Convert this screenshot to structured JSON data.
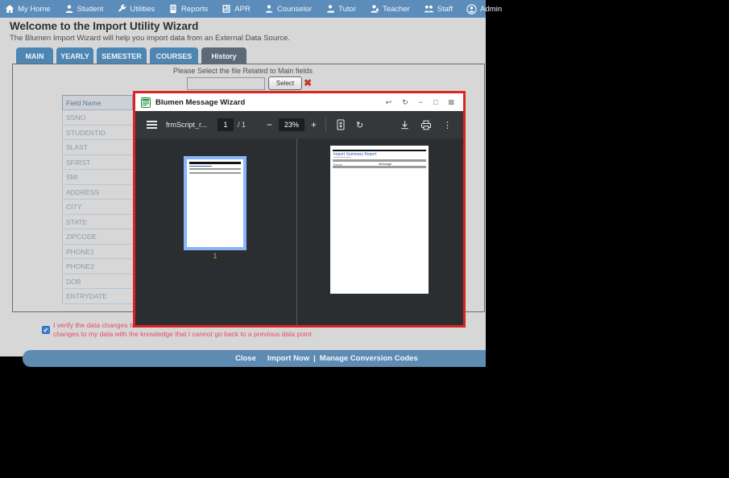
{
  "navbar": {
    "items": [
      {
        "label": "My Home",
        "icon": "home-icon"
      },
      {
        "label": "Student",
        "icon": "student-icon"
      },
      {
        "label": "Utilities",
        "icon": "wrench-icon"
      },
      {
        "label": "Reports",
        "icon": "report-icon"
      },
      {
        "label": "APR",
        "icon": "apr-book-icon"
      },
      {
        "label": "Counselor",
        "icon": "counselor-icon"
      },
      {
        "label": "Tutor",
        "icon": "tutor-icon"
      },
      {
        "label": "Teacher",
        "icon": "teacher-icon"
      },
      {
        "label": "Staff",
        "icon": "staff-group-icon"
      },
      {
        "label": "Admin",
        "icon": "admin-circle-icon"
      }
    ]
  },
  "header": {
    "title": "Welcome to the Import Utility Wizard",
    "subtitle": "The Blumen Import Wizard will help you import data from an External Data Source."
  },
  "tabs": [
    {
      "label": "MAIN",
      "active": false
    },
    {
      "label": "YEARLY",
      "active": false
    },
    {
      "label": "SEMESTER",
      "active": false
    },
    {
      "label": "COURSES",
      "active": false
    },
    {
      "label": "History",
      "active": true
    }
  ],
  "file_select": {
    "instruction": "Please Select the file Related to Main fields",
    "input_value": "",
    "select_label": "Select",
    "remove_glyph": "✖"
  },
  "field_table": {
    "header": "Field Name",
    "rows": [
      "SSNO",
      "STUDENTID",
      "SLAST",
      "SFIRST",
      "SMI",
      "ADDRESS",
      "CITY",
      "STATE",
      "ZIPCODE",
      "PHONE1",
      "PHONE2",
      "DOB",
      "ENTRYDATE"
    ]
  },
  "verify": {
    "checked_glyph": "✔",
    "line1": "I verify the data changes to",
    "line2": "changes to my data with the knowledge that I cannot go back to a previous data point."
  },
  "footer": {
    "close": "Close",
    "import_now": "Import Now",
    "separator": "|",
    "manage": "Manage Conversion Codes"
  },
  "modal": {
    "title": "Blumen Message Wizard",
    "window_controls": {
      "undo": "↩",
      "refresh": "↻",
      "minimize": "−",
      "maximize": "□",
      "close": "⊠"
    },
    "toolbar": {
      "filename": "frmScript_r...",
      "page_current": "1",
      "page_total": "/ 1",
      "zoom_out": "−",
      "zoom_level": "23%",
      "zoom_in": "+",
      "rotate_glyph": "↻",
      "dots_glyph": "⋮"
    },
    "thumbnail_page_number": "1",
    "preview": {
      "report_title": "Import Summary Report",
      "left_label": "Errors",
      "column_label": "Message"
    }
  },
  "colors": {
    "navbar_blue": "#5b8cba",
    "tab_blue": "#4e86b3",
    "tab_active_gray": "#5b6a76",
    "modal_highlight_red": "#df2222",
    "pdf_toolbar_dark": "#34383b",
    "thumb_selection_blue": "#8ab4f8",
    "verify_text_red": "#e74c64",
    "footer_blue": "#5e8bb2"
  }
}
